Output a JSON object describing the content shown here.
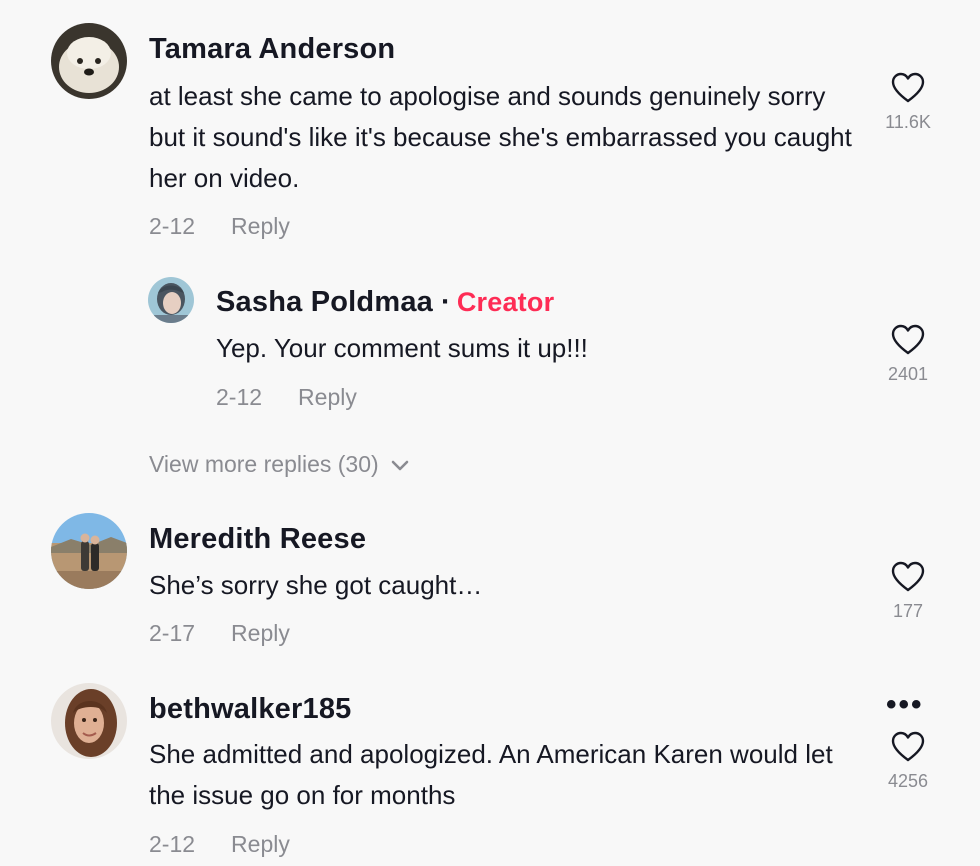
{
  "comments": [
    {
      "username": "Tamara Anderson",
      "text": "at least she came to apologise and sounds genuinely sorry but it sound's like it's because she's embarrassed you caught her on video.",
      "date": "2-12",
      "reply_label": "Reply",
      "like_count": "11.6K",
      "avatar_icon": "white-dog-avatar"
    },
    {
      "username": "Meredith Reese",
      "text": "She’s sorry she got caught…",
      "date": "2-17",
      "reply_label": "Reply",
      "like_count": "177",
      "avatar_icon": "hiking-couple-avatar"
    },
    {
      "username": "bethwalker185",
      "text": "She admitted and apologized. An American Karen would let the issue go on for months",
      "date": "2-12",
      "reply_label": "Reply",
      "like_count": "4256",
      "avatar_icon": "woman-portrait-avatar",
      "more_icon": "more-options-icon"
    }
  ],
  "reply": {
    "username": "Sasha Poldmaa",
    "separator": "·",
    "badge": "Creator",
    "text": "Yep. Your comment sums it up!!!",
    "date": "2-12",
    "reply_label": "Reply",
    "like_count": "2401",
    "avatar_icon": "sasha-avatar"
  },
  "view_more": {
    "label": "View more replies (30)",
    "icon": "chevron-down-icon"
  },
  "colors": {
    "background": "#f8f8f8",
    "text": "#161823",
    "secondary": "#8a8b91",
    "creator": "#fe2c55"
  }
}
